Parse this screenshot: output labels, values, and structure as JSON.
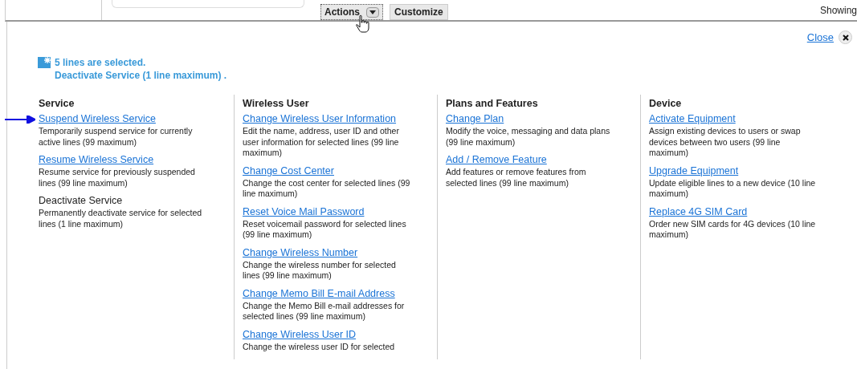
{
  "toolbar": {
    "actions_button": "Actions",
    "customize_button": "Customize",
    "showing_text": "Showing"
  },
  "panel": {
    "close_link": "Close",
    "message": {
      "line_1": "5 lines are selected.",
      "line_2": "Deactivate Service (1 line maximum) ."
    },
    "columns": [
      {
        "heading": "Service",
        "items": [
          {
            "label": "Suspend Wireless Service",
            "description": "Temporarily suspend service for currently active lines (99 maximum)",
            "disabled": false,
            "pointed": true
          },
          {
            "label": "Resume Wireless Service",
            "description": "Resume service for previously suspended lines (99 line maximum)",
            "disabled": false,
            "pointed": false
          },
          {
            "label": "Deactivate Service",
            "description": "Permanently deactivate service for selected lines (1 line maximum)",
            "disabled": true,
            "pointed": false
          }
        ]
      },
      {
        "heading": "Wireless User",
        "items": [
          {
            "label": "Change Wireless User Information",
            "description": "Edit the name, address, user ID and other user information for selected lines (99 line maximum)",
            "disabled": false,
            "pointed": false
          },
          {
            "label": "Change Cost Center",
            "description": "Change the cost center for selected lines (99 line maximum)",
            "disabled": false,
            "pointed": false
          },
          {
            "label": "Reset Voice Mail Password",
            "description": "Reset voicemail password for selected lines (99 line maximum)",
            "disabled": false,
            "pointed": false
          },
          {
            "label": "Change Wireless Number",
            "description": "Change the wireless number for selected lines (99 line maximum)",
            "disabled": false,
            "pointed": false
          },
          {
            "label": "Change Memo Bill E-mail Address",
            "description": "Change the Memo Bill e-mail addresses for selected lines (99 line maximum)",
            "disabled": false,
            "pointed": false
          },
          {
            "label": "Change Wireless User ID",
            "description": "Change the wireless user ID for selected",
            "disabled": false,
            "pointed": false
          }
        ]
      },
      {
        "heading": "Plans and Features",
        "items": [
          {
            "label": "Change Plan",
            "description": "Modify the voice, messaging and data plans (99 line maximum)",
            "disabled": false,
            "pointed": false
          },
          {
            "label": "Add / Remove Feature",
            "description": "Add features or remove features from selected lines (99 line maximum)",
            "disabled": false,
            "pointed": false
          }
        ]
      },
      {
        "heading": "Device",
        "items": [
          {
            "label": "Activate Equipment",
            "description": "Assign existing devices to users or swap devices between two users (99 line maximum)",
            "disabled": false,
            "pointed": false
          },
          {
            "label": "Upgrade Equipment",
            "description": "Update eligible lines to a new device (10 line maximum)",
            "disabled": false,
            "pointed": false
          },
          {
            "label": "Replace 4G SIM Card",
            "description": "Order new SIM cards for 4G devices (10 line maximum)",
            "disabled": false,
            "pointed": false
          }
        ]
      }
    ]
  }
}
